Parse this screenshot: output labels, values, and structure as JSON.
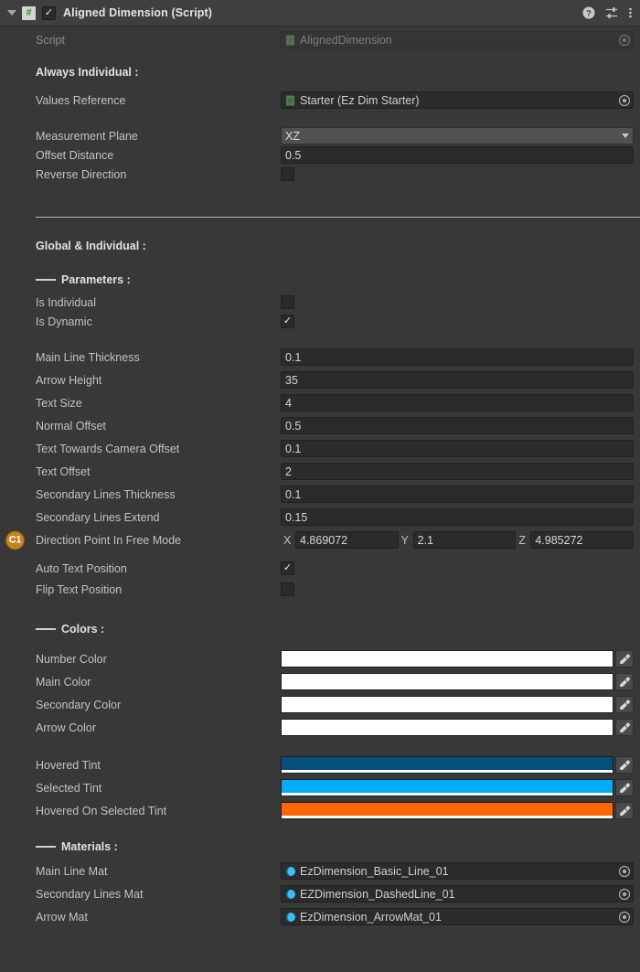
{
  "header": {
    "title": "Aligned Dimension (Script)",
    "enabled_checkmark": "✓",
    "script_icon": "csharp-script-icon",
    "help_icon": "help-icon",
    "preset_icon": "preset-icon",
    "menu_icon": "more-menu-icon"
  },
  "script_row": {
    "label": "Script",
    "value": "AlignedDimension"
  },
  "always_individual": {
    "heading": "Always Individual :",
    "values_reference": {
      "label": "Values Reference",
      "value": "Starter (Ez Dim Starter)"
    },
    "measurement_plane": {
      "label": "Measurement Plane",
      "value": "XZ"
    },
    "offset_distance": {
      "label": "Offset Distance",
      "value": "0.5"
    },
    "reverse_direction": {
      "label": "Reverse Direction",
      "checked": false,
      "checkmark": ""
    }
  },
  "global_individual": {
    "heading": "Global & Individual :",
    "parameters_heading": "Parameters :",
    "colors_heading": "Colors :",
    "materials_heading": "Materials :",
    "parameters": [
      {
        "label": "Is Individual",
        "type": "checkbox",
        "value": ""
      },
      {
        "label": "Is Dynamic",
        "type": "checkbox",
        "value": "✓"
      },
      {
        "label": "Main Line Thickness",
        "type": "text",
        "value": "0.1"
      },
      {
        "label": "Arrow Height",
        "type": "text",
        "value": "35"
      },
      {
        "label": "Text Size",
        "type": "text",
        "value": "4"
      },
      {
        "label": "Normal Offset",
        "type": "text",
        "value": "0.5"
      },
      {
        "label": "Text Towards Camera Offset",
        "type": "text",
        "value": "0.1"
      },
      {
        "label": "Text Offset",
        "type": "text",
        "value": "2"
      },
      {
        "label": "Secondary Lines Thickness",
        "type": "text",
        "value": "0.1"
      },
      {
        "label": "Secondary Lines Extend",
        "type": "text",
        "value": "0.15"
      }
    ],
    "direction_point": {
      "badge": "C1",
      "label": "Direction Point In Free Mode",
      "x_axis": "X",
      "x": "4.869072",
      "y_axis": "Y",
      "y": "2.1",
      "z_axis": "Z",
      "z": "4.985272"
    },
    "auto_text_position": {
      "label": "Auto Text Position",
      "checkmark": "✓"
    },
    "flip_text_position": {
      "label": "Flip Text Position",
      "checkmark": ""
    },
    "colors": [
      {
        "label": "Number Color",
        "hex": "#ffffff",
        "alpha_bar": false
      },
      {
        "label": "Main Color",
        "hex": "#ffffff",
        "alpha_bar": false
      },
      {
        "label": "Secondary Color",
        "hex": "#ffffff",
        "alpha_bar": false
      },
      {
        "label": "Arrow Color",
        "hex": "#ffffff",
        "alpha_bar": false
      },
      {
        "label": "Hovered Tint",
        "hex": "#064f7c",
        "alpha_bar": true
      },
      {
        "label": "Selected Tint",
        "hex": "#00adfb",
        "alpha_bar": true
      },
      {
        "label": "Hovered On Selected Tint",
        "hex": "#fb6607",
        "alpha_bar": true
      }
    ],
    "materials": [
      {
        "label": "Main Line Mat",
        "value": "EzDimension_Basic_Line_01"
      },
      {
        "label": "Secondary Lines Mat",
        "value": "EZDimension_DashedLine_01"
      },
      {
        "label": "Arrow Mat",
        "value": "EzDimension_ArrowMat_01"
      }
    ]
  },
  "icon_names": {
    "eyedropper": "eyedropper-icon",
    "object_picker": "object-picker-icon",
    "material_sphere": "material-sphere-icon",
    "script_asset": "script-asset-icon"
  }
}
